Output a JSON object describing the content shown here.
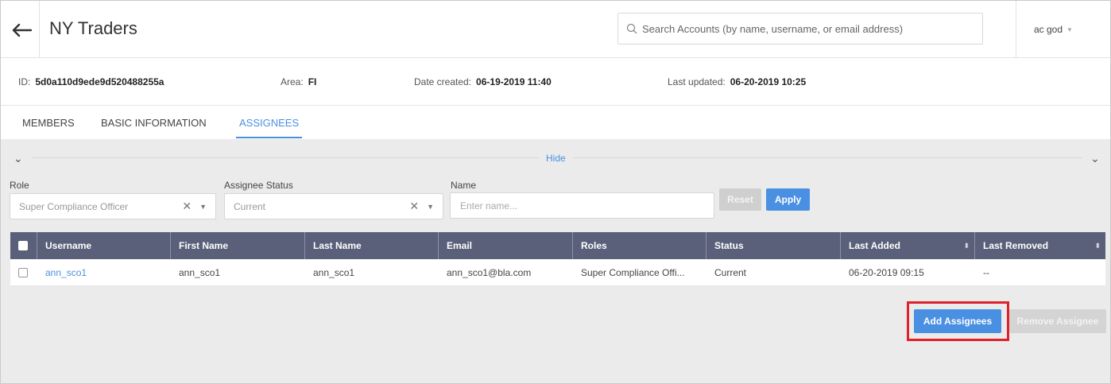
{
  "header": {
    "title": "NY Traders",
    "search_placeholder": "Search Accounts (by name, username, or email address)",
    "user": "ac god"
  },
  "info": {
    "id_label": "ID:",
    "id_value": "5d0a110d9ede9d520488255a",
    "area_label": "Area:",
    "area_value": "FI",
    "created_label": "Date created:",
    "created_value": "06-19-2019 11:40",
    "updated_label": "Last updated:",
    "updated_value": "06-20-2019 10:25"
  },
  "tabs": [
    {
      "label": "MEMBERS",
      "active": false
    },
    {
      "label": "BASIC INFORMATION",
      "active": false
    },
    {
      "label": "ASSIGNEES",
      "active": true
    }
  ],
  "filters": {
    "hide_label": "Hide",
    "role_label": "Role",
    "role_value": "Super Compliance Officer",
    "status_label": "Assignee Status",
    "status_value": "Current",
    "name_label": "Name",
    "name_placeholder": "Enter name...",
    "reset_label": "Reset",
    "apply_label": "Apply"
  },
  "table": {
    "columns": [
      "Username",
      "First Name",
      "Last Name",
      "Email",
      "Roles",
      "Status",
      "Last Added",
      "Last Removed"
    ],
    "rows": [
      {
        "username": "ann_sco1",
        "first_name": "ann_sco1",
        "last_name": "ann_sco1",
        "email": "ann_sco1@bla.com",
        "roles": "Super Compliance Offi...",
        "status": "Current",
        "last_added": "06-20-2019 09:15",
        "last_removed": "--"
      }
    ]
  },
  "actions": {
    "add_label": "Add Assignees",
    "remove_label": "Remove Assignee"
  },
  "colors": {
    "accent": "#4a90e2",
    "table_header": "#5a607a",
    "highlight": "#e0202a"
  }
}
